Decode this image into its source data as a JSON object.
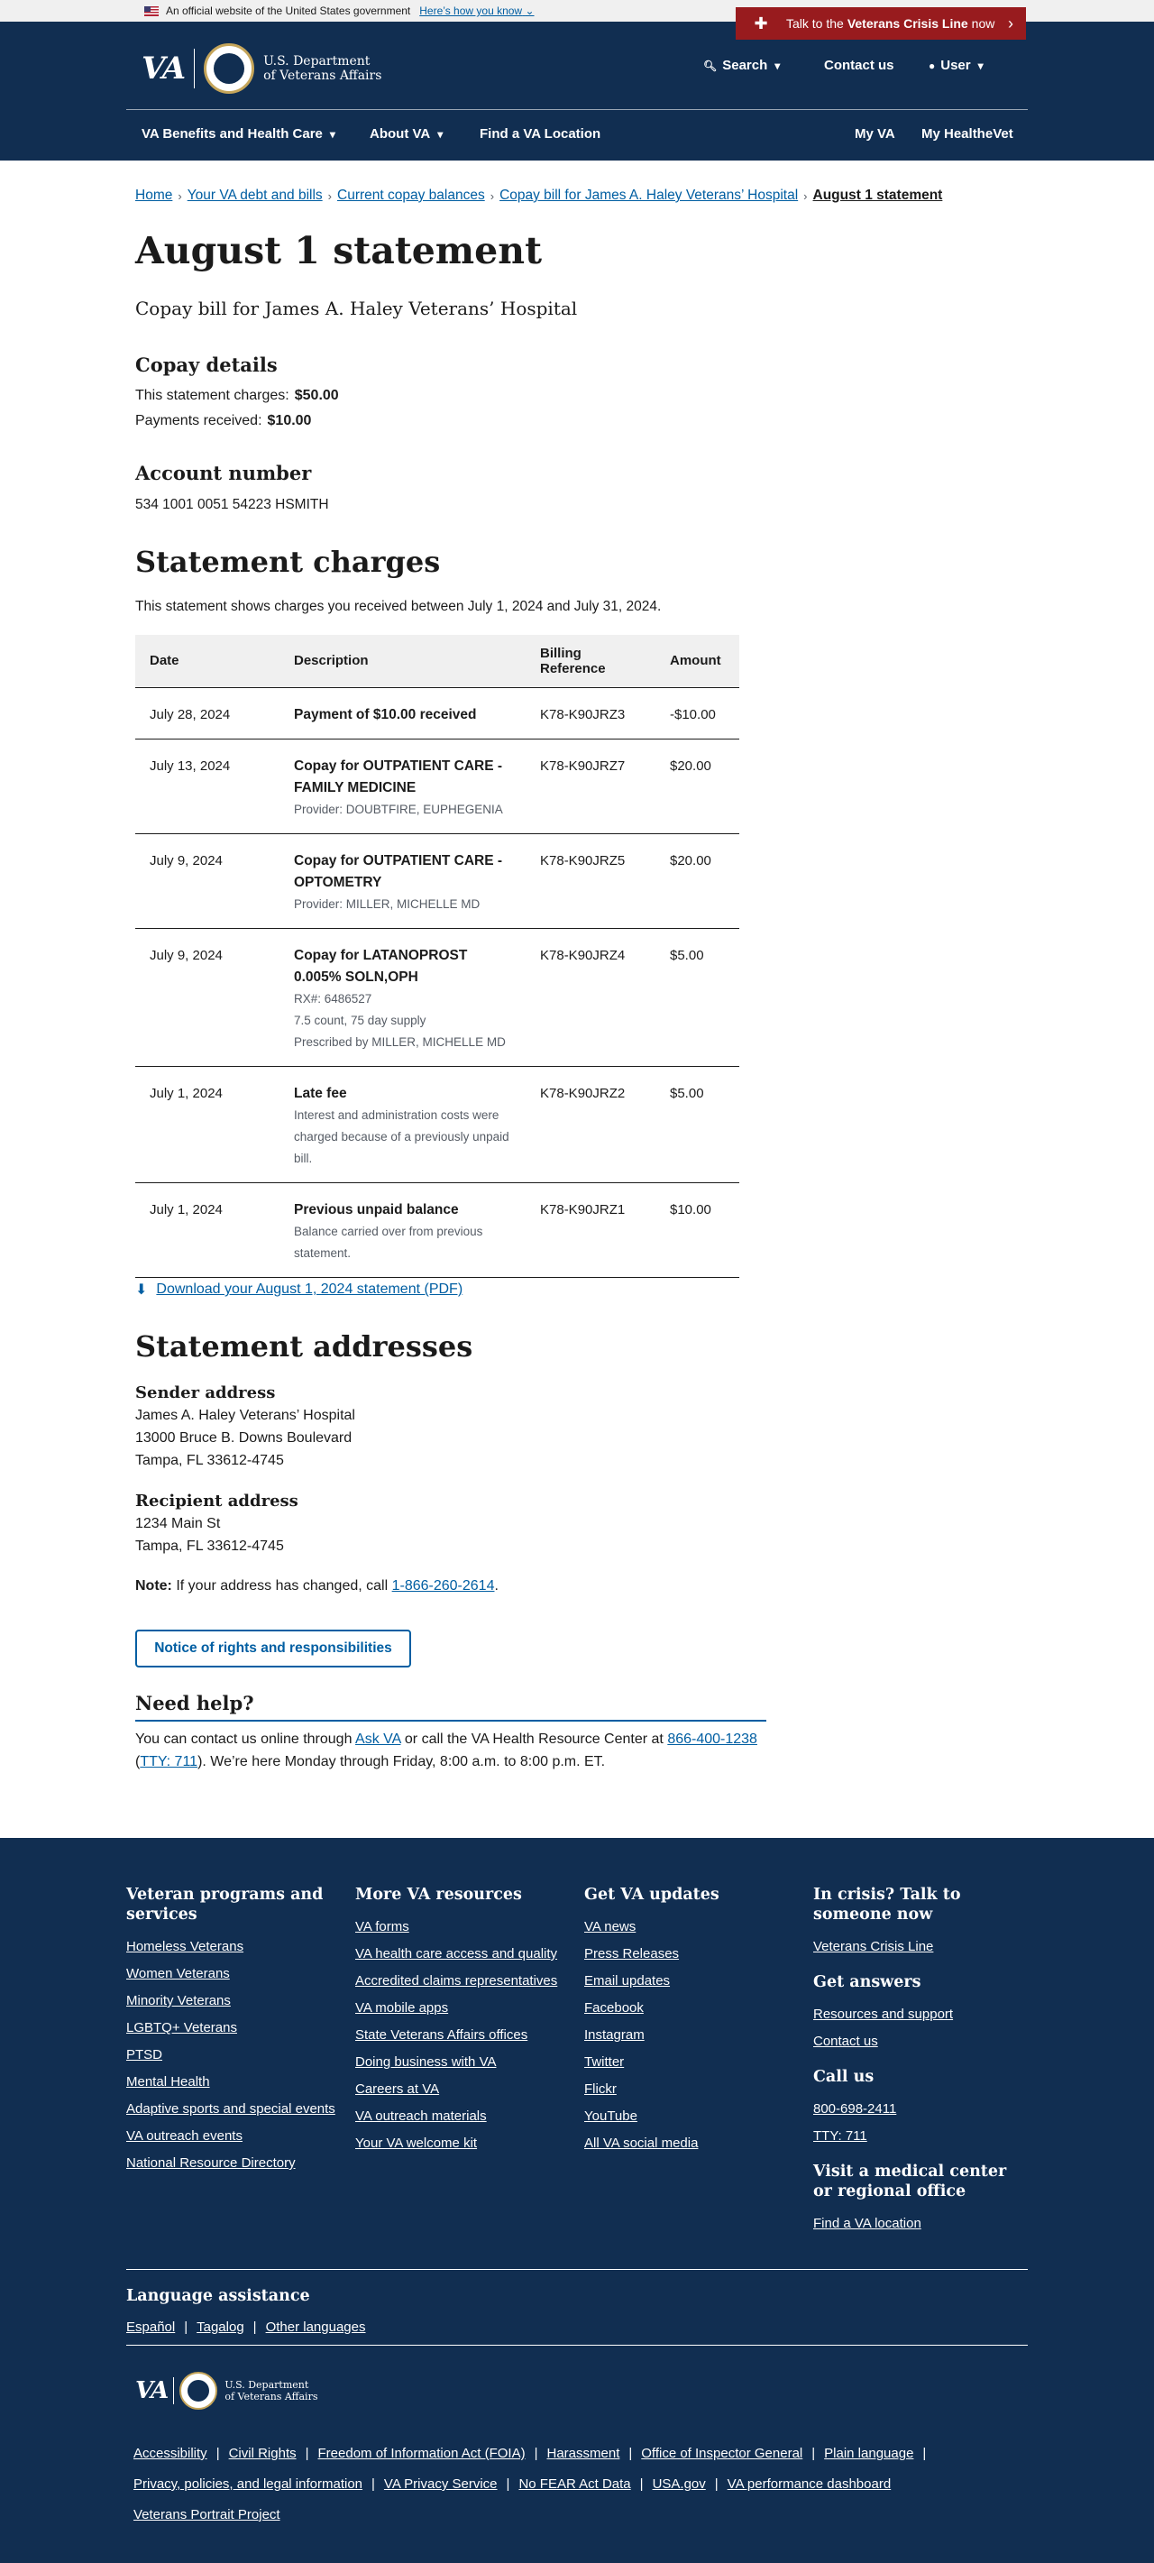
{
  "gov_banner": {
    "text": "An official website of the United States government",
    "link": "Here’s how you know"
  },
  "header": {
    "crisis": {
      "pre": "Talk to the",
      "bold": "Veterans Crisis Line",
      "post": "now"
    },
    "logo": {
      "mark": "VA",
      "dept_line1": "U.S. Department",
      "dept_line2": "of Veterans Affairs"
    },
    "utility": {
      "search": "Search",
      "contact": "Contact us",
      "user": "User"
    },
    "menu": {
      "benefits": "VA Benefits and Health Care",
      "about": "About VA",
      "find": "Find a VA Location",
      "myva": "My VA",
      "healthevet": "My HealtheVet"
    }
  },
  "breadcrumbs": [
    "Home",
    "Your VA debt and bills",
    "Current copay balances",
    "Copay bill for James A. Haley Veterans’ Hospital",
    "August 1 statement"
  ],
  "page": {
    "title": "August 1 statement",
    "subtitle": "Copay bill for James A. Haley Veterans’ Hospital",
    "copay_details": {
      "heading": "Copay details",
      "charges_label": "This statement charges:",
      "charges_value": "$50.00",
      "payments_label": "Payments received:",
      "payments_value": "$10.00"
    },
    "account": {
      "heading": "Account number",
      "value": "534 1001 0051 54223 HSMITH"
    },
    "charges": {
      "heading": "Statement charges",
      "intro": "This statement shows charges you received between July 1, 2024 and July 31, 2024.",
      "columns": [
        "Date",
        "Description",
        "Billing Reference",
        "Amount"
      ],
      "rows": [
        {
          "date": "July 28, 2024",
          "title": "Payment of $10.00 received",
          "m1": "",
          "m2": "",
          "m3": "",
          "ref": "K78-K90JRZ3",
          "amount": "-$10.00"
        },
        {
          "date": "July 13, 2024",
          "title": "Copay for OUTPATIENT CARE - FAMILY MEDICINE",
          "m1": "Provider: DOUBTFIRE, EUPHEGENIA",
          "m2": "",
          "m3": "",
          "ref": "K78-K90JRZ7",
          "amount": "$20.00"
        },
        {
          "date": "July 9, 2024",
          "title": "Copay for OUTPATIENT CARE - OPTOMETRY",
          "m1": "Provider: MILLER, MICHELLE MD",
          "m2": "",
          "m3": "",
          "ref": "K78-K90JRZ5",
          "amount": "$20.00"
        },
        {
          "date": "July 9, 2024",
          "title": "Copay for LATANOPROST 0.005% SOLN,OPH",
          "m1": "RX#: 6486527",
          "m2": "7.5 count, 75 day supply",
          "m3": "Prescribed by MILLER, MICHELLE MD",
          "ref": "K78-K90JRZ4",
          "amount": "$5.00"
        },
        {
          "date": "July 1, 2024",
          "title": "Late fee",
          "m1": "Interest and administration costs were charged because of a previously unpaid bill.",
          "m2": "",
          "m3": "",
          "ref": "K78-K90JRZ2",
          "amount": "$5.00"
        },
        {
          "date": "July 1, 2024",
          "title": "Previous unpaid balance",
          "m1": "Balance carried over from previous statement.",
          "m2": "",
          "m3": "",
          "ref": "K78-K90JRZ1",
          "amount": "$10.00"
        }
      ]
    },
    "download": "Download your August 1, 2024 statement (PDF)",
    "addresses": {
      "heading": "Statement addresses",
      "sender_label": "Sender address",
      "sender": [
        "James A. Haley Veterans’ Hospital",
        "13000 Bruce B. Downs Boulevard",
        "Tampa, FL 33612-4745"
      ],
      "recipient_label": "Recipient address",
      "recipient": [
        "1234 Main St",
        "Tampa, FL 33612-4745"
      ],
      "note_label": "Note:",
      "note_text": "If your address has changed, call",
      "note_phone": "1-866-260-2614"
    },
    "rights_button": "Notice of rights and responsibilities",
    "help": {
      "heading": "Need help?",
      "t1": "You can contact us online through",
      "ask_va": "Ask VA",
      "t2": "or call the VA Health Resource Center at",
      "phone": "866-400-1238",
      "tty": "TTY: 711",
      "t3": "). We’re here Monday through Friday, 8:00 a.m. to 8:00 p.m. ET."
    }
  },
  "footer": {
    "col1": {
      "heading": "Veteran programs and services",
      "links": [
        "Homeless Veterans",
        "Women Veterans",
        "Minority Veterans",
        "LGBTQ+ Veterans",
        "PTSD",
        "Mental Health",
        "Adaptive sports and special events",
        "VA outreach events",
        "National Resource Directory"
      ]
    },
    "col2": {
      "heading": "More VA resources",
      "links": [
        "VA forms",
        "VA health care access and quality",
        "Accredited claims representatives",
        "VA mobile apps",
        "State Veterans Affairs offices",
        "Doing business with VA",
        "Careers at VA",
        "VA outreach materials",
        "Your VA welcome kit"
      ]
    },
    "col3": {
      "heading": "Get VA updates",
      "links": [
        "VA news",
        "Press Releases",
        "Email updates",
        "Facebook",
        "Instagram",
        "Twitter",
        "Flickr",
        "YouTube",
        "All VA social media"
      ]
    },
    "col4": {
      "crisis_heading": "In crisis? Talk to someone now",
      "crisis_link": "Veterans Crisis Line",
      "answers_heading": "Get answers",
      "answers_links": [
        "Resources and support",
        "Contact us"
      ],
      "call_heading": "Call us",
      "call_links": [
        "800-698-2411",
        "TTY: 711"
      ],
      "visit_heading": "Visit a medical center or regional office",
      "visit_link": "Find a VA location"
    },
    "language": {
      "heading": "Language assistance",
      "links": [
        "Español",
        "Tagalog",
        "Other languages"
      ]
    },
    "bottom_links": [
      "Accessibility",
      "Civil Rights",
      "Freedom of Information Act (FOIA)",
      "Harassment",
      "Office of Inspector General",
      "Plain language",
      "Privacy, policies, and legal information",
      "VA Privacy Service",
      "No FEAR Act Data",
      "USA.gov",
      "VA performance dashboard",
      "Veterans Portrait Project"
    ]
  }
}
